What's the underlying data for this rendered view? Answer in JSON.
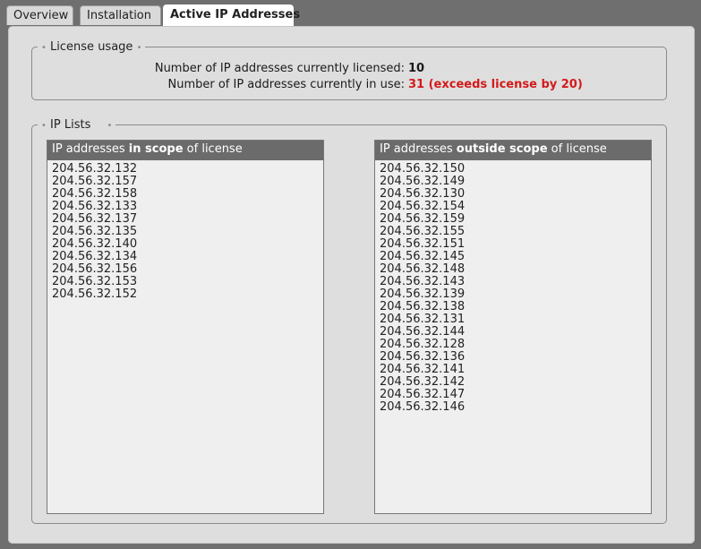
{
  "tabs": [
    {
      "label": "Overview"
    },
    {
      "label": "Installation"
    },
    {
      "label": "Active IP Addresses"
    }
  ],
  "license_usage": {
    "legend": "License usage",
    "licensed_label": "Number of IP addresses currently licensed:",
    "licensed_value": "10",
    "in_use_label": "Number of IP addresses currently in use:",
    "in_use_value": "31 (exceeds license by 20)",
    "warn_color": "#d41a1a"
  },
  "ip_lists": {
    "legend": "IP Lists",
    "in_scope": {
      "header_prefix": "IP addresses ",
      "header_bold": "in scope",
      "header_suffix": " of license",
      "items": [
        "204.56.32.132",
        "204.56.32.157",
        "204.56.32.158",
        "204.56.32.133",
        "204.56.32.137",
        "204.56.32.135",
        "204.56.32.140",
        "204.56.32.134",
        "204.56.32.156",
        "204.56.32.153",
        "204.56.32.152"
      ]
    },
    "outside_scope": {
      "header_prefix": "IP addresses ",
      "header_bold": "outside scope",
      "header_suffix": " of license",
      "items": [
        "204.56.32.150",
        "204.56.32.149",
        "204.56.32.130",
        "204.56.32.154",
        "204.56.32.159",
        "204.56.32.155",
        "204.56.32.151",
        "204.56.32.145",
        "204.56.32.148",
        "204.56.32.143",
        "204.56.32.139",
        "204.56.32.138",
        "204.56.32.131",
        "204.56.32.144",
        "204.56.32.128",
        "204.56.32.136",
        "204.56.32.141",
        "204.56.32.142",
        "204.56.32.147",
        "204.56.32.146"
      ]
    }
  }
}
